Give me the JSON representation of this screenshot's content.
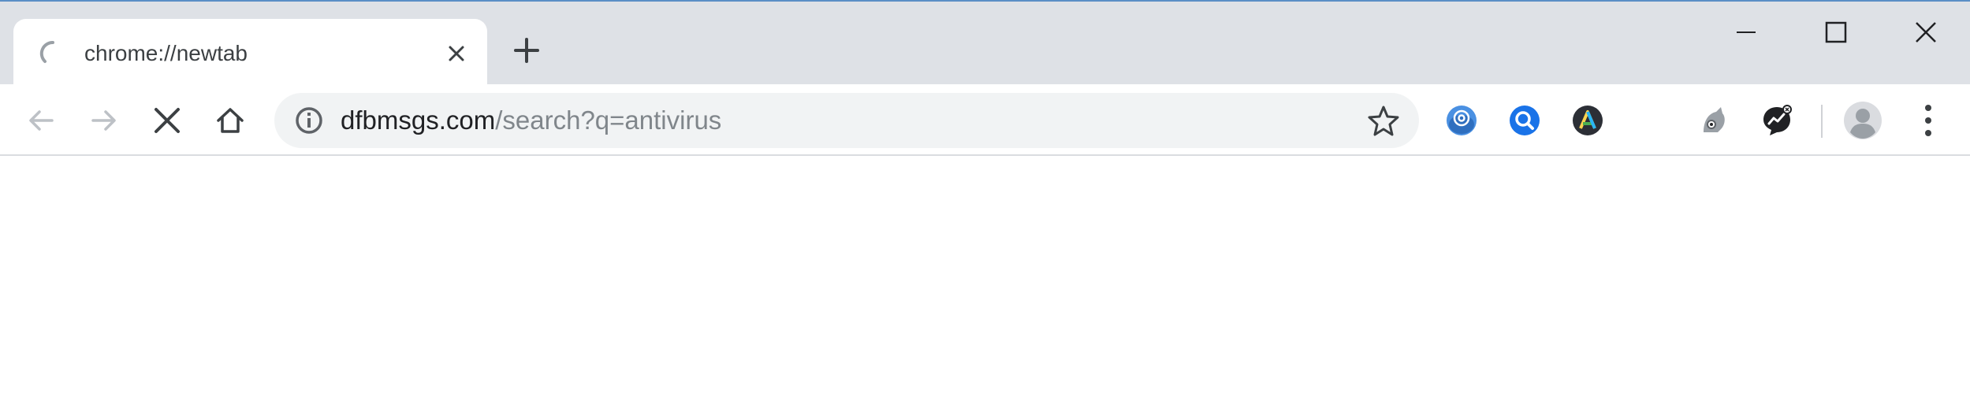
{
  "tab": {
    "title": "chrome://newtab",
    "loading": true
  },
  "address_bar": {
    "host": "dfbmsgs.com",
    "path": "/search?q=antivirus"
  },
  "toolbar": {
    "back_icon": "arrow-left-icon",
    "forward_icon": "arrow-right-icon",
    "stop_icon": "close-x-icon",
    "home_icon": "home-icon",
    "bookmark_icon": "star-outline-icon",
    "menu_icon": "kebab-menu-icon"
  },
  "extensions": [
    {
      "name": "email-extension-icon",
      "color": "#4a90e2"
    },
    {
      "name": "search-extension-icon",
      "color": "#1a73e8"
    },
    {
      "name": "a-extension-icon",
      "color": "#2c2f36"
    },
    {
      "name": "cat-extension-icon",
      "color": "#9aa0a6"
    },
    {
      "name": "chart-extension-icon",
      "color": "#202124"
    }
  ],
  "colors": {
    "titlebar": "#dee1e6",
    "tab_bg": "#ffffff",
    "omnibox_bg": "#f1f3f4",
    "accent_border": "#5a8ec6"
  }
}
